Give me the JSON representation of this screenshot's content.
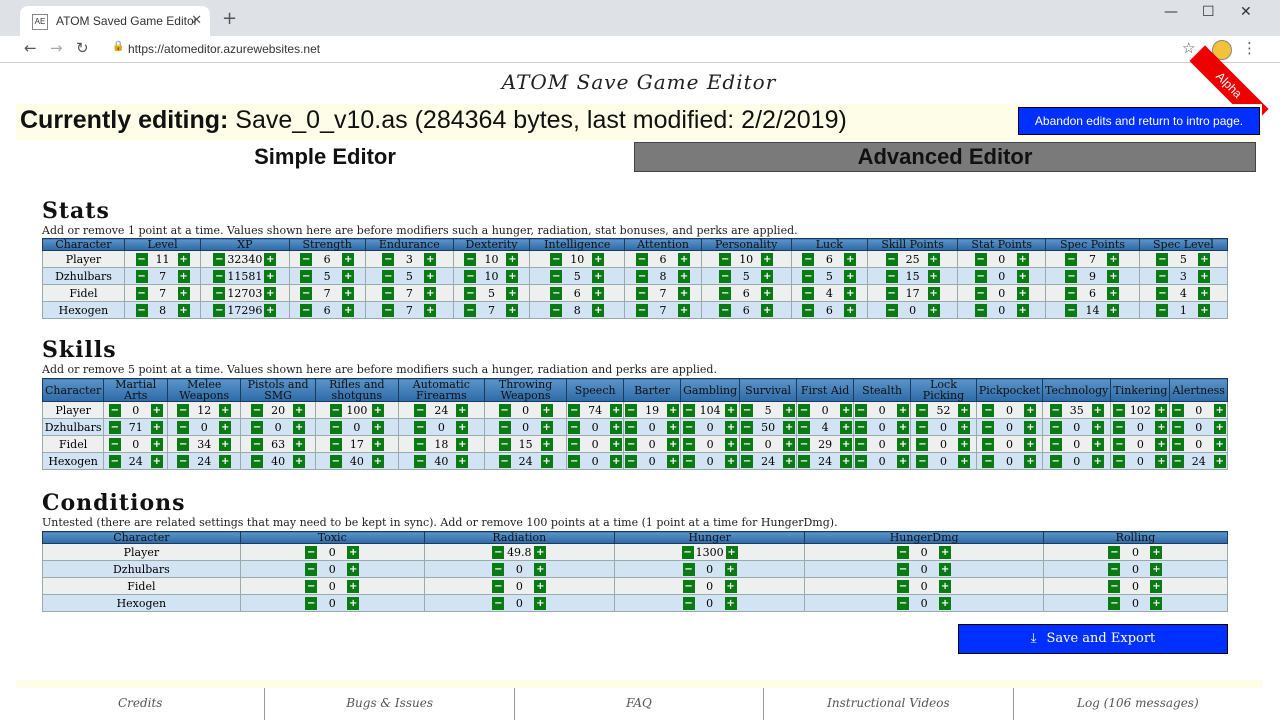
{
  "browser": {
    "tab_title": "ATOM Saved Game Editor",
    "favicon": "AE",
    "close": "✕",
    "new_tab": "+",
    "url": "https://atomeditor.azurewebsites.net",
    "min": "—",
    "max": "☐",
    "win_close": "✕"
  },
  "site": {
    "title": "ATOM Save Game Editor",
    "ribbon": "Alpha",
    "editing_label": "Currently editing:",
    "editing_file": "Save_0_v10.as (284364 bytes, last modified: 2/2/2019)",
    "abandon": "Abandon edits and return to intro page.",
    "tab_simple": "Simple Editor",
    "tab_advanced": "Advanced Editor",
    "save": "Save and Export"
  },
  "stats": {
    "title": "Stats",
    "desc": "Add or remove 1 point at a time. Values shown here are before modifiers such a hunger, radiation, stat bonuses, and perks are applied.",
    "headers": [
      "Character",
      "Level",
      "XP",
      "Strength",
      "Endurance",
      "Dexterity",
      "Intelligence",
      "Attention",
      "Personality",
      "Luck",
      "Skill Points",
      "Stat Points",
      "Spec Points",
      "Spec Level"
    ],
    "rows": [
      [
        "Player",
        "11",
        "32340",
        "6",
        "3",
        "10",
        "10",
        "6",
        "10",
        "6",
        "25",
        "0",
        "7",
        "5"
      ],
      [
        "Dzhulbars",
        "7",
        "11581",
        "5",
        "5",
        "10",
        "5",
        "8",
        "5",
        "5",
        "15",
        "0",
        "9",
        "3"
      ],
      [
        "Fidel",
        "7",
        "12703",
        "7",
        "7",
        "5",
        "6",
        "7",
        "6",
        "4",
        "17",
        "0",
        "6",
        "4"
      ],
      [
        "Hexogen",
        "8",
        "17296",
        "6",
        "7",
        "7",
        "8",
        "7",
        "6",
        "6",
        "0",
        "0",
        "14",
        "1"
      ]
    ]
  },
  "skills": {
    "title": "Skills",
    "desc": "Add or remove 5 point at a time. Values shown here are before modifiers such a hunger, radiation and perks are applied.",
    "headers": [
      "Character",
      "Martial Arts",
      "Melee Weapons",
      "Pistols and SMG",
      "Rifles and shotguns",
      "Automatic Firearms",
      "Throwing Weapons",
      "Speech",
      "Barter",
      "Gambling",
      "Survival",
      "First Aid",
      "Stealth",
      "Lock Picking",
      "Pickpocket",
      "Technology",
      "Tinkering",
      "Alertness"
    ],
    "rows": [
      [
        "Player",
        "0",
        "12",
        "20",
        "100",
        "24",
        "0",
        "74",
        "19",
        "104",
        "5",
        "0",
        "0",
        "52",
        "0",
        "35",
        "102",
        "0"
      ],
      [
        "Dzhulbars",
        "71",
        "0",
        "0",
        "0",
        "0",
        "0",
        "0",
        "0",
        "0",
        "50",
        "4",
        "0",
        "0",
        "0",
        "0",
        "0",
        "0"
      ],
      [
        "Fidel",
        "0",
        "34",
        "63",
        "17",
        "18",
        "15",
        "0",
        "0",
        "0",
        "0",
        "29",
        "0",
        "0",
        "0",
        "0",
        "0",
        "0"
      ],
      [
        "Hexogen",
        "24",
        "24",
        "40",
        "40",
        "40",
        "24",
        "0",
        "0",
        "0",
        "24",
        "24",
        "0",
        "0",
        "0",
        "0",
        "0",
        "24"
      ]
    ]
  },
  "conditions": {
    "title": "Conditions",
    "desc": "Untested (there are related settings that may need to be kept in sync). Add or remove 100 points at a time (1 point at a time for HungerDmg).",
    "headers": [
      "Character",
      "Toxic",
      "Radiation",
      "Hunger",
      "HungerDmg",
      "Rolling"
    ],
    "rows": [
      [
        "Player",
        "0",
        "49.8",
        "1300",
        "0",
        "0"
      ],
      [
        "Dzhulbars",
        "0",
        "0",
        "0",
        "0",
        "0"
      ],
      [
        "Fidel",
        "0",
        "0",
        "0",
        "0",
        "0"
      ],
      [
        "Hexogen",
        "0",
        "0",
        "0",
        "0",
        "0"
      ]
    ]
  },
  "footer": [
    "Credits",
    "Bugs & Issues",
    "FAQ",
    "Instructional Videos",
    "Log (106 messages)"
  ],
  "symbols": {
    "minus": "−",
    "plus": "+"
  }
}
